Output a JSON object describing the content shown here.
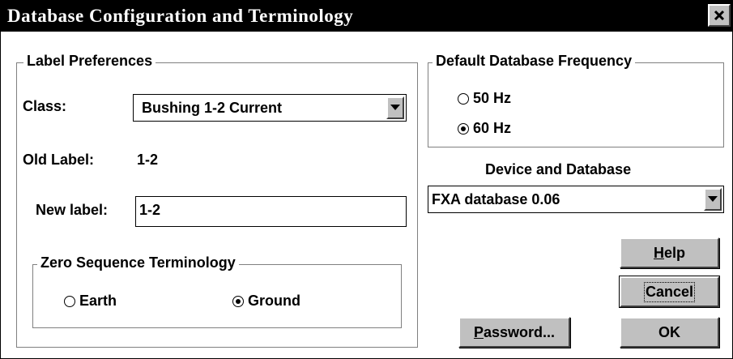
{
  "window": {
    "title": "Database Configuration and Terminology",
    "close_glyph": "×"
  },
  "label_prefs": {
    "legend": "Label Preferences",
    "class_label": "Class:",
    "class_value": "Bushing 1-2 Current",
    "old_label_label": "Old Label:",
    "old_label_value": "1-2",
    "new_label_label": "New label:",
    "new_label_value": "1-2"
  },
  "zero_seq": {
    "legend": "Zero Sequence Terminology",
    "options": [
      {
        "label": "Earth",
        "checked": false
      },
      {
        "label": "Ground",
        "checked": true
      }
    ]
  },
  "frequency": {
    "legend": "Default Database Frequency",
    "options": [
      {
        "label": "50 Hz",
        "checked": false
      },
      {
        "label": "60 Hz",
        "checked": true
      }
    ]
  },
  "device": {
    "heading": "Device and Database",
    "value": "FXA database 0.06"
  },
  "buttons": {
    "help": {
      "underline": "H",
      "rest": "elp"
    },
    "cancel": "Cancel",
    "ok": "OK",
    "password": {
      "underline": "P",
      "rest": "assword..."
    }
  },
  "icons": {
    "close": "close-icon",
    "dropdown": "chevron-down-icon",
    "radio": "radio-icon"
  }
}
